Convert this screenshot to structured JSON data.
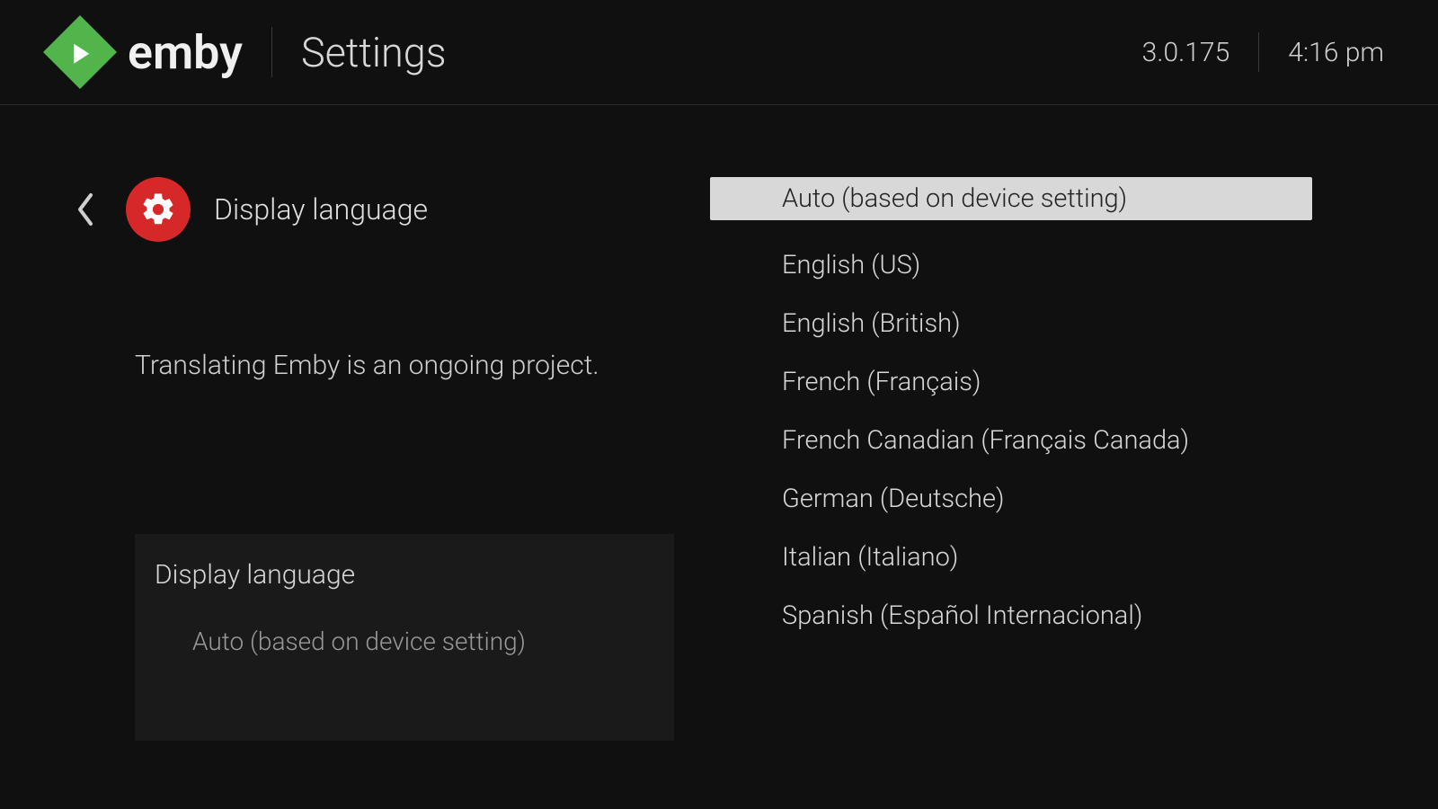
{
  "header": {
    "brand": "emby",
    "title": "Settings",
    "version": "3.0.175",
    "time": "4:16 pm"
  },
  "section": {
    "title": "Display language",
    "description": "Translating Emby is an ongoing project."
  },
  "card": {
    "title": "Display language",
    "value": "Auto (based on device setting)"
  },
  "options": [
    "Auto (based on device setting)",
    "English (US)",
    "English (British)",
    "French (Français)",
    "French Canadian (Français Canada)",
    "German (Deutsche)",
    "Italian (Italiano)",
    "Spanish (Español Internacional)"
  ],
  "selectedIndex": 0
}
